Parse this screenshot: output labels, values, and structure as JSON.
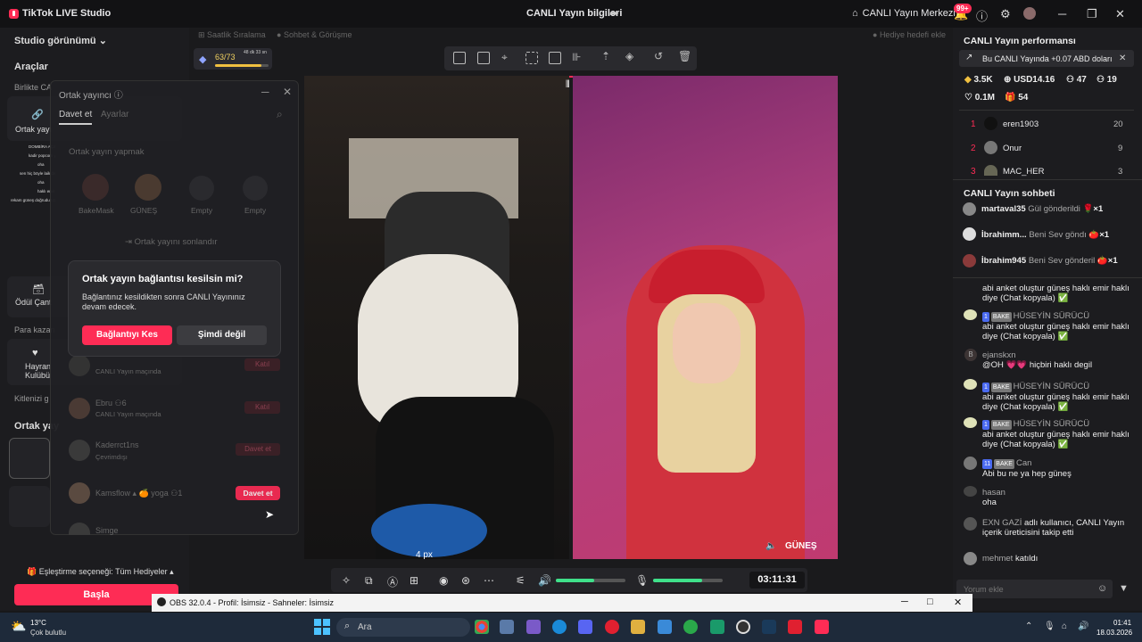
{
  "titlebar": {
    "app_name": "TikTok LIVE Studio",
    "center_title": "CANLI Yayın bilgileri",
    "center_link": "CANLI Yayın Merkezi",
    "notif_badge": "99+",
    "window_buttons": [
      "─",
      "❐",
      "✕"
    ]
  },
  "left": {
    "studio_view": "Studio görünümü",
    "tools": "Araçlar",
    "together": "Birlikte CA",
    "co_host": "Ortak yayı",
    "gift_box": "Ödül Çant",
    "earn": "Para kazan",
    "fan_club": "Hayran\nKulübü",
    "find_fans": "Kitlenizi g",
    "co_host_section": "Ortak yay",
    "matching": "Eşleştirme seçeneği: Tüm Hediyeler",
    "start": "Başla"
  },
  "chips": {
    "hourly": "Saatlik Sıralama",
    "chat_meet": "Sohbet & Görüşme",
    "gift_goal": "Hediye hedefi ekle",
    "progress_text": "63/73",
    "progress_time": "48 dk 33 sn",
    "progress_fraction": 0.86
  },
  "cohost": {
    "title": "Ortak yayıncı",
    "tab_invite": "Davet et",
    "tab_settings": "Ayarlar",
    "section": "Ortak yayın yapmak",
    "slots": [
      "BakeMask",
      "GÜNEŞ",
      "Empty",
      "Empty"
    ],
    "end_label": "Ortak yayını sonlandır",
    "list": [
      {
        "name": "",
        "sub": "CANLI Yayın maçında",
        "btn": "Katıl"
      },
      {
        "name": "Ebru",
        "count": "6",
        "sub": "CANLI Yayın maçında",
        "btn": "Katıl"
      },
      {
        "name": "Kaderrct1ns",
        "sub": "Çevrimdışı",
        "btn": "Davet et"
      },
      {
        "name": "Kamsflow",
        "suffix": "yoga",
        "count": "1",
        "sub": "",
        "btn": "Davet et"
      },
      {
        "name": "Simge",
        "sub": "",
        "btn": ""
      }
    ]
  },
  "dialog": {
    "title": "Ortak yayın bağlantısı kesilsin mi?",
    "body": "Bağlantınız kesildikten sonra CANLI Yayınınız devam edecek.",
    "confirm": "Bağlantıyı Kes",
    "cancel": "Şimdi değil"
  },
  "stage": {
    "right_caption": "GÜNEŞ",
    "bottom_caption": "4 px",
    "timer": "03:11:31",
    "volume_fraction": 0.55,
    "mic_fraction": 0.7
  },
  "mini_chat": [
    "DOMBİRA AÇSANA ABİ @bakemask",
    "kadir popcorn yaşa",
    "oha",
    "sen hiç böyle laik değilsin dedi abart güneş",
    "oha",
    "haklı emir",
    "rekam güneş doğruduz mert üyleyiz"
  ],
  "right": {
    "perf_title": "CANLI Yayın performansı",
    "perf_banner": "Bu CANLI Yayında +0.07 ABD doları",
    "stats": [
      "3.5K",
      "USD14.16",
      "47",
      "19",
      "0.1M",
      "54"
    ],
    "ranking": [
      {
        "rank": "1",
        "name": "eren1903",
        "score": "20"
      },
      {
        "rank": "2",
        "name": "Onur",
        "score": "9"
      },
      {
        "rank": "3",
        "name": "MAC_HER",
        "score": "3"
      }
    ],
    "chat_title": "CANLI Yayın sohbeti",
    "gifts": [
      {
        "user": "martaval35",
        "text": "Gül gönderildi",
        "count": "×1"
      },
      {
        "user": "İbrahimm...",
        "text": "Beni Sev göndı",
        "count": "×1"
      },
      {
        "user": "İbrahim945",
        "text": "Beni Sev gönderil",
        "count": "×1"
      }
    ],
    "messages": [
      {
        "user": "",
        "text": "abi anket oluştur güneş haklı emir haklı diye (Chat kopyala) ✅"
      },
      {
        "user": "HÜSEYİN SÜRÜCÜ",
        "lvl": "1",
        "tag": "BAKE",
        "text": "abi anket oluştur güneş haklı emir haklı diye (Chat kopyala) ✅"
      },
      {
        "user": "ejanskxn",
        "text": "@OH 💗💗 hiçbiri haklı degil"
      },
      {
        "user": "HÜSEYİN SÜRÜCÜ",
        "lvl": "1",
        "tag": "BAKE",
        "text": "abi anket oluştur güneş haklı emir haklı diye (Chat kopyala) ✅"
      },
      {
        "user": "HÜSEYİN SÜRÜCÜ",
        "lvl": "1",
        "tag": "BAKE",
        "text": "abi anket oluştur güneş haklı emir haklı diye (Chat kopyala) ✅"
      },
      {
        "user": "Can",
        "lvl": "11",
        "tag": "BAKE",
        "text": "Abi bu ne ya hep güneş"
      },
      {
        "user": "hasan",
        "text": "oha"
      },
      {
        "user": "EXN GAZİ",
        "text": "adlı kullanıcı, CANLI Yayın içerik üreticisini takip etti"
      },
      {
        "user": "mehmet",
        "text": "katıldı"
      }
    ],
    "comment_placeholder": "Yorum ekle"
  },
  "obs": {
    "title": "OBS 32.0.4 - Profil: İsimsiz - Sahneler: İsimsiz"
  },
  "taskbar": {
    "weather_temp": "13°C",
    "weather_desc": "Çok bulutlu",
    "search": "Ara",
    "time": "01:41",
    "date": "18.03.2026"
  }
}
